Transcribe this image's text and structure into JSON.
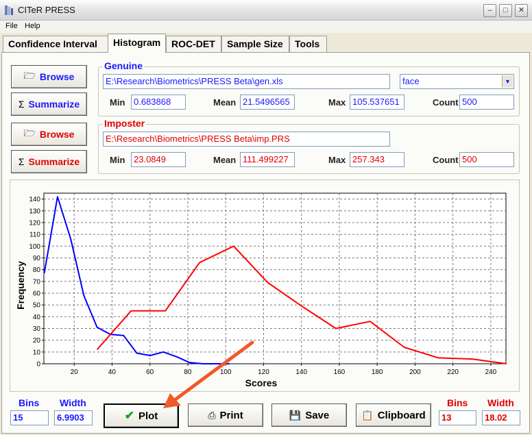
{
  "window": {
    "title": "CITeR PRESS"
  },
  "menu": {
    "items": [
      "File",
      "Help"
    ]
  },
  "tabs": [
    "Confidence Interval",
    "Histogram",
    "ROC-DET",
    "Sample Size",
    "Tools"
  ],
  "genuine": {
    "label": "Genuine",
    "browse": "Browse",
    "summarize": "Summarize",
    "path": "E:\\Research\\Biometrics\\PRESS Beta\\gen.xls",
    "modality": "face",
    "min_label": "Min",
    "min": "0.683868",
    "mean_label": "Mean",
    "mean": "21.5496565",
    "max_label": "Max",
    "max": "105.537651",
    "count_label": "Count",
    "count": "500"
  },
  "imposter": {
    "label": "Imposter",
    "browse": "Browse",
    "summarize": "Summarize",
    "path": "E:\\Research\\Biometrics\\PRESS Beta\\imp.PRS",
    "min_label": "Min",
    "min": "23.0849",
    "mean_label": "Mean",
    "mean": "111.499227",
    "max_label": "Max",
    "max": "257.343",
    "count_label": "Count",
    "count": "500"
  },
  "bottom": {
    "bins_label": "Bins",
    "width_label": "Width",
    "genuine_bins": "15",
    "genuine_width": "6.9903",
    "imposter_bins": "13",
    "imposter_width": "18.02",
    "plot": "Plot",
    "print": "Print",
    "save": "Save",
    "clipboard": "Clipboard"
  },
  "colors": {
    "genuine": "#0000ff",
    "imposter": "#ff0000",
    "arrow": "#f05a28"
  },
  "chart_data": {
    "type": "line",
    "xlabel": "Scores",
    "ylabel": "Frequency",
    "xlim": [
      4,
      248
    ],
    "ylim": [
      0,
      145
    ],
    "xticks": [
      20,
      40,
      60,
      80,
      100,
      120,
      140,
      160,
      180,
      200,
      220,
      240
    ],
    "yticks": [
      0,
      10,
      20,
      30,
      40,
      50,
      60,
      70,
      80,
      90,
      100,
      110,
      120,
      130,
      140
    ],
    "grid": true,
    "series": [
      {
        "color": "#0000ff",
        "x": [
          4.2,
          11.2,
          18.2,
          25.1,
          32.1,
          39.1,
          46.1,
          53.1,
          60.1,
          67.1,
          74.0,
          81.0,
          88.0,
          95.0,
          102.0
        ],
        "y": [
          77,
          142,
          106,
          58,
          31,
          25,
          24,
          9,
          7,
          10,
          6,
          1,
          0,
          0,
          0
        ]
      },
      {
        "color": "#ff0000",
        "x": [
          32.1,
          50.1,
          68.2,
          86.2,
          104.2,
          122.2,
          140.2,
          158.2,
          176.3,
          194.3,
          212.3,
          230.3,
          248.3
        ],
        "y": [
          12,
          45,
          45,
          86,
          100,
          69,
          49,
          30,
          36,
          14,
          5,
          4,
          0
        ]
      }
    ]
  }
}
